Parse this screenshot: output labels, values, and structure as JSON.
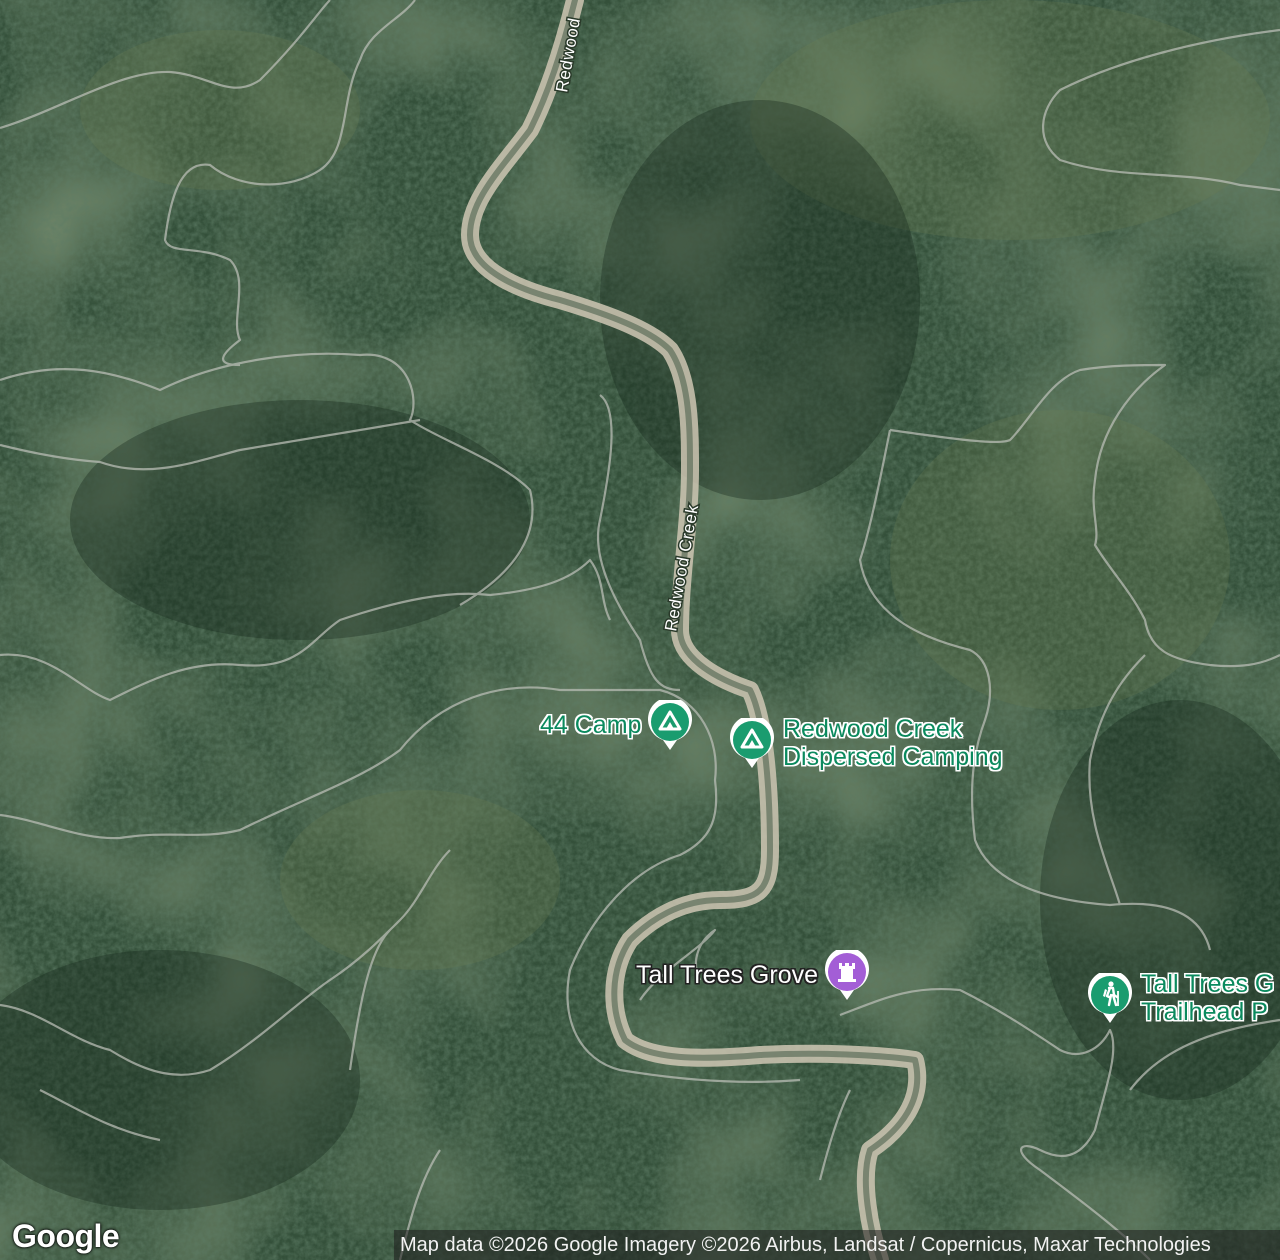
{
  "map": {
    "type": "satellite",
    "road_labels": [
      "Redwood",
      "Redwood Creek"
    ]
  },
  "pois": {
    "camp44": {
      "label": "44 Camp",
      "icon": "campground-icon",
      "color": "#1a9c6f"
    },
    "redwood_creek_camping": {
      "label_line1": "Redwood Creek",
      "label_line2": "Dispersed Camping",
      "icon": "campground-icon",
      "color": "#1a9c6f"
    },
    "tall_trees_grove": {
      "label": "Tall Trees Grove",
      "icon": "monument-icon",
      "color": "#a35ed6"
    },
    "tall_trees_trailhead": {
      "label_line1": "Tall Trees G",
      "label_line2": "Trailhead P",
      "icon": "hiking-icon",
      "color": "#1a9c6f"
    }
  },
  "footer": {
    "logo": "Google",
    "attribution": "Map data ©2026 Google Imagery ©2026 Airbus, Landsat / Copernicus, Maxar Technologies"
  }
}
